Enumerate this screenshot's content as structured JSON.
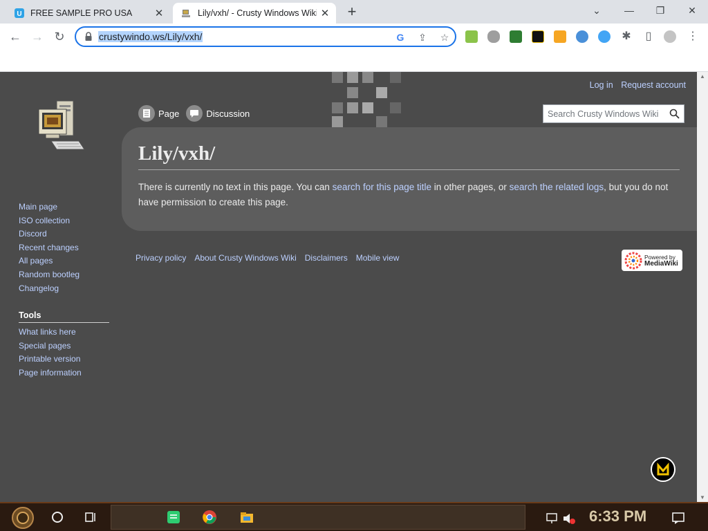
{
  "browser": {
    "tabs": [
      {
        "title": "FREE SAMPLE PRO USA",
        "active": false
      },
      {
        "title": "Lily/vxh/ - Crusty Windows Wiki",
        "active": true
      }
    ],
    "new_tab_label": "+",
    "window_controls": {
      "minimize": "—",
      "restore": "❐",
      "close": "✕",
      "tab_search": "⌄"
    },
    "url": "crustywindo.ws/Lily/vxh/",
    "extensions": [
      "green-ext-icon",
      "gamepad-ext-icon",
      "idol-ext-icon",
      "media-ext-icon",
      "pumpkin-ext-icon",
      "globe-ext-icon",
      "planet-ext-icon",
      "puzzle-icon",
      "sidepanel-icon",
      "profile-icon",
      "menu-icon"
    ]
  },
  "wiki": {
    "personal": {
      "login": "Log in",
      "request_account": "Request account"
    },
    "tabs": {
      "page": "Page",
      "discussion": "Discussion"
    },
    "search": {
      "placeholder": "Search Crusty Windows Wiki"
    },
    "title": "Lily/vxh/",
    "body": {
      "text1": "There is currently no text in this page. You can ",
      "link1": "search for this page title",
      "text2": " in other pages, or ",
      "link2": "search the related logs",
      "text3": ", but you do not have permission to create this page."
    },
    "sidebar": {
      "navigation": [
        "Main page",
        "ISO collection",
        "Discord",
        "Recent changes",
        "All pages",
        "Random bootleg",
        "Changelog"
      ],
      "tools_heading": "Tools",
      "tools": [
        "What links here",
        "Special pages",
        "Printable version",
        "Page information"
      ]
    },
    "footer": [
      "Privacy policy",
      "About Crusty Windows Wiki",
      "Disclaimers",
      "Mobile view"
    ],
    "powered_by": {
      "line1": "Powered by",
      "line2": "MediaWiki"
    }
  },
  "taskbar": {
    "clock": "6:33 PM",
    "accent": "#6a3a18"
  },
  "colors": {
    "page_bg": "#4b4b4b",
    "content_bg": "#5d5d5d",
    "link": "#bcd0ff",
    "omnibox_focus": "#1a73e8"
  }
}
